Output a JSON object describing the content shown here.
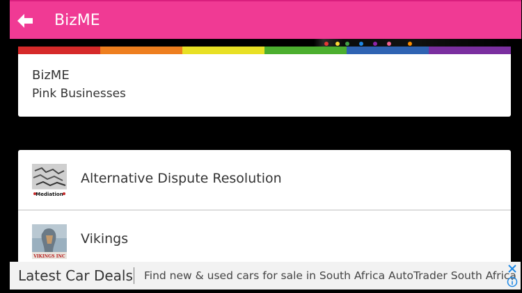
{
  "topbar": {
    "title": "BizME",
    "color": "#f03a94",
    "back_icon": "back-arrow-icon"
  },
  "rainbow_colors": [
    "#d62a2a",
    "#ee7f1f",
    "#e8e024",
    "#4caf2f",
    "#2f63b3",
    "#7b2fa0"
  ],
  "header_card": {
    "name": "BizME",
    "category": "Pink Businesses"
  },
  "listings": [
    {
      "label": "Alternative Dispute Resolution",
      "thumb_caption": "Mediation"
    },
    {
      "label": "Vikings",
      "thumb_caption": "VIKINGS INC"
    }
  ],
  "ad": {
    "headline": "Latest Car Deals",
    "description": "Find new & used cars for sale in South Africa AutoTrader South Africa",
    "close_icon": "close-icon",
    "info_icon": "info-icon"
  }
}
